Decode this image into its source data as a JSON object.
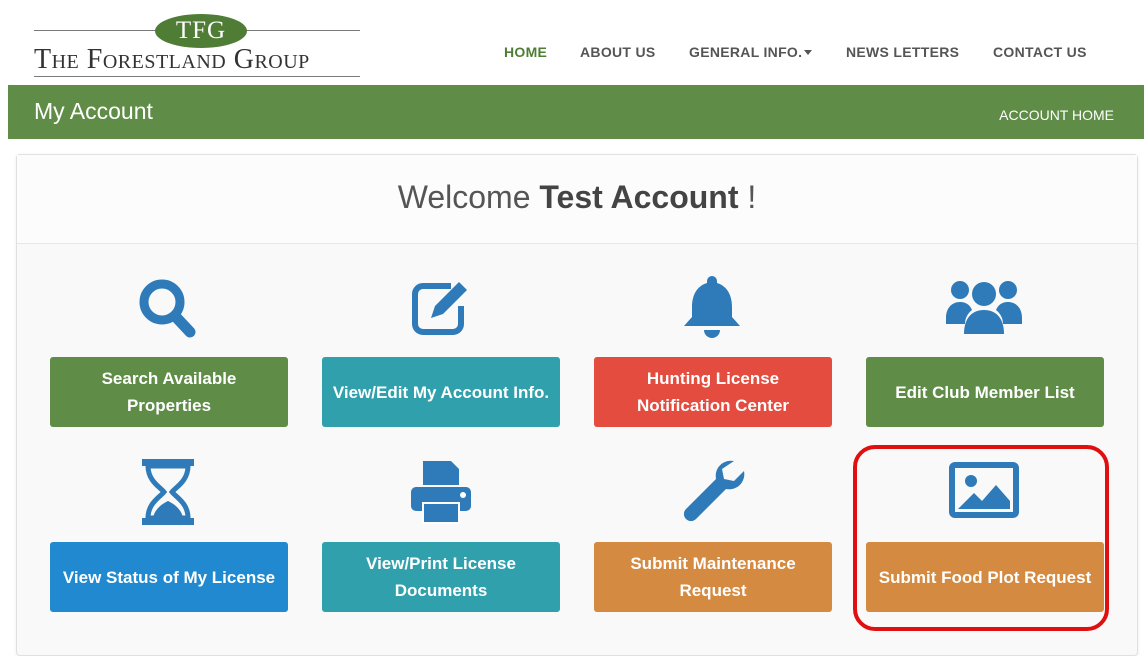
{
  "logo": {
    "mark": "TFG",
    "name": "The Forestland Group"
  },
  "nav": {
    "home": "HOME",
    "about": "ABOUT US",
    "general": "GENERAL INFO.",
    "newsletters": "NEWS LETTERS",
    "contact": "CONTACT US",
    "active": "HOME"
  },
  "account_bar": {
    "title": "My Account",
    "home_link": "ACCOUNT HOME"
  },
  "welcome": {
    "prefix": "Welcome",
    "name": "Test Account",
    "suffix": "!"
  },
  "tiles": [
    {
      "label": "Search Available Properties",
      "icon": "search-icon",
      "color": "#5f8c46"
    },
    {
      "label": "View/Edit My Account Info.",
      "icon": "edit-icon",
      "color": "#31a0ad"
    },
    {
      "label": "Hunting License Notification Center",
      "icon": "bell-icon",
      "color": "#e34c3e"
    },
    {
      "label": "Edit Club Member List",
      "icon": "users-icon",
      "color": "#5f8c46"
    },
    {
      "label": "View Status of My License",
      "icon": "hourglass-icon",
      "color": "#2089cf"
    },
    {
      "label": "View/Print License Documents",
      "icon": "printer-icon",
      "color": "#31a0ad"
    },
    {
      "label": "Submit Maintenance Request",
      "icon": "wrench-icon",
      "color": "#d48a40"
    },
    {
      "label": "Submit Food Plot Request",
      "icon": "image-icon",
      "color": "#d48a40"
    }
  ],
  "colors": {
    "brand_green": "#5f8c46",
    "icon_blue": "#2f7ab8",
    "highlight": "#e01010"
  }
}
